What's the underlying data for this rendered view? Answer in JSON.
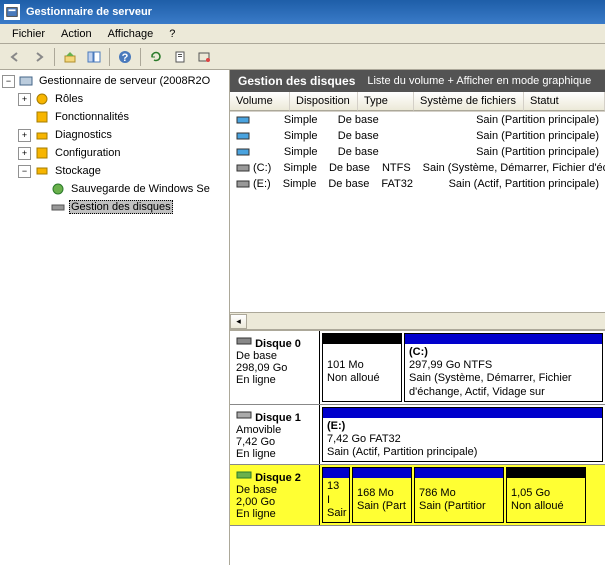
{
  "window": {
    "title": "Gestionnaire de serveur"
  },
  "menu": {
    "file": "Fichier",
    "action": "Action",
    "view": "Affichage",
    "help": "?"
  },
  "tree": {
    "root": "Gestionnaire de serveur (2008R2O",
    "roles": "Rôles",
    "features": "Fonctionnalités",
    "diag": "Diagnostics",
    "config": "Configuration",
    "storage": "Stockage",
    "backup": "Sauvegarde de Windows Se",
    "diskmgmt": "Gestion des disques"
  },
  "panel": {
    "title": "Gestion des disques",
    "subtitle": "Liste du volume + Afficher en mode graphique"
  },
  "cols": {
    "volume": "Volume",
    "layout": "Disposition",
    "type": "Type",
    "fs": "Système de fichiers",
    "status": "Statut"
  },
  "rows": [
    {
      "vol": "",
      "icon": "blue",
      "layout": "Simple",
      "type": "De base",
      "fs": "",
      "status": "Sain (Partition principale)"
    },
    {
      "vol": "",
      "icon": "blue",
      "layout": "Simple",
      "type": "De base",
      "fs": "",
      "status": "Sain (Partition principale)"
    },
    {
      "vol": "",
      "icon": "blue",
      "layout": "Simple",
      "type": "De base",
      "fs": "",
      "status": "Sain (Partition principale)"
    },
    {
      "vol": "(C:)",
      "icon": "gray",
      "layout": "Simple",
      "type": "De base",
      "fs": "NTFS",
      "status": "Sain (Système, Démarrer, Fichier d'échange, Actif, V"
    },
    {
      "vol": "(E:)",
      "icon": "gray",
      "layout": "Simple",
      "type": "De base",
      "fs": "FAT32",
      "status": "Sain (Actif, Partition principale)"
    }
  ],
  "disks": {
    "d0": {
      "name": "Disque 0",
      "type": "De base",
      "size": "298,09 Go",
      "state": "En ligne",
      "p0": {
        "size": "101 Mo",
        "status": "Non alloué"
      },
      "p1": {
        "name": "(C:)",
        "size": "297,99 Go NTFS",
        "status": "Sain (Système, Démarrer, Fichier d'échange, Actif, Vidage sur"
      }
    },
    "d1": {
      "name": "Disque 1",
      "type": "Amovible",
      "size": "7,42 Go",
      "state": "En ligne",
      "p0": {
        "name": "(E:)",
        "size": "7,42 Go FAT32",
        "status": "Sain (Actif, Partition principale)"
      }
    },
    "d2": {
      "name": "Disque 2",
      "type": "De base",
      "size": "2,00 Go",
      "state": "En ligne",
      "p0": {
        "size": "13 I",
        "status": "Sair"
      },
      "p1": {
        "size": "168 Mo",
        "status": "Sain (Part"
      },
      "p2": {
        "size": "786 Mo",
        "status": "Sain (Partitior"
      },
      "p3": {
        "size": "1,05 Go",
        "status": "Non alloué"
      }
    }
  },
  "colors": {
    "titlebar": "#2a6bb8",
    "header": "#535353",
    "disk2bg": "#ffff33",
    "partbar_blue": "#0000cc",
    "partbar_black": "#000000"
  }
}
